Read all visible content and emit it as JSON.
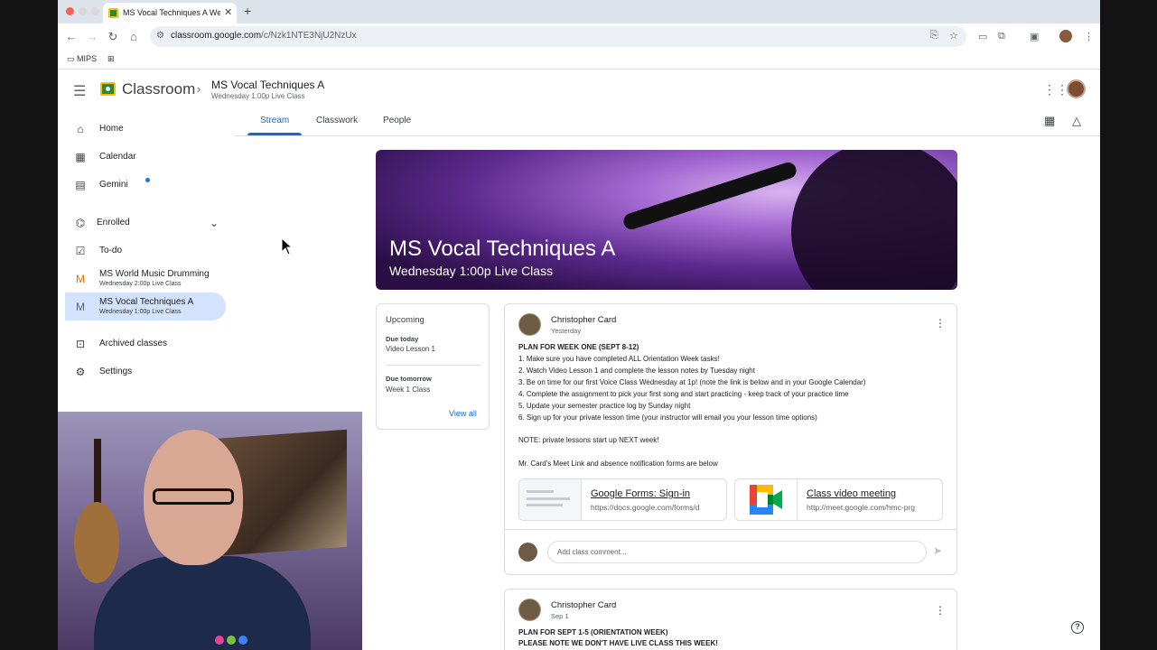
{
  "browser": {
    "tab_title": "MS Vocal Techniques A Wedn",
    "tab_close": "✕",
    "new_tab": "+",
    "url_host": "classroom.google.com",
    "url_path": "/c/Nzk1NTE3NjU2NzUx",
    "bookmarks": [
      {
        "label": "MIPS",
        "icon": "folder-icon"
      },
      {
        "label": "",
        "icon": "apps-grid-icon"
      }
    ]
  },
  "header": {
    "app_name": "Classroom",
    "class_name": "MS Vocal Techniques A",
    "class_sub": "Wednesday 1:00p Live Class"
  },
  "tabs": [
    {
      "label": "Stream",
      "active": true
    },
    {
      "label": "Classwork",
      "active": false
    },
    {
      "label": "People",
      "active": false
    }
  ],
  "sidebar": {
    "items": [
      {
        "label": "Home",
        "icon": "home-icon"
      },
      {
        "label": "Calendar",
        "icon": "calendar-icon"
      },
      {
        "label": "Gemini",
        "icon": "gemini-icon"
      },
      {
        "label": "Enrolled",
        "icon": "enrolled-icon"
      },
      {
        "label": "To-do",
        "icon": "todo-icon"
      },
      {
        "label": "MS World Music Drumming",
        "sub": "Wednesday 2:00p Live Class",
        "letter": "M"
      },
      {
        "label": "MS Vocal Techniques A",
        "sub": "Wednesday 1:00p Live Class",
        "letter": "M"
      },
      {
        "label": "Archived classes",
        "icon": "archive-icon"
      },
      {
        "label": "Settings",
        "icon": "gear-icon"
      }
    ]
  },
  "banner": {
    "title": "MS Vocal Techniques A",
    "subtitle": "Wednesday 1:00p Live Class"
  },
  "upcoming": {
    "title": "Upcoming",
    "due_today_label": "Due today",
    "due_today_item": "Video Lesson 1",
    "due_tomorrow_label": "Due tomorrow",
    "due_tomorrow_item": "Week 1 Class",
    "view_all": "View all"
  },
  "posts": [
    {
      "author": "Christopher Card",
      "date": "Yesterday",
      "lines": [
        "PLAN FOR WEEK ONE (SEPT 8-12)",
        "1.  Make sure you have completed ALL Orientation Week tasks!",
        "2.  Watch Video Lesson 1 and complete the lesson notes by Tuesday night",
        "3.  Be on time for our first Voice Class Wednesday at 1p!  (note the link is below and in your Google Calendar)",
        "4.  Complete the assignment to pick your first song and start practicing - keep track of your practice time",
        "5.  Update your semester practice log by Sunday night",
        "6.  Sign up for your private lesson time (your instructor will email you your lesson time options)",
        "NOTE:  private lessons start up NEXT week!",
        "Mr. Card's Meet Link and absence notification forms are below"
      ],
      "attachments": [
        {
          "title": "Google Forms: Sign-in",
          "url": "https://docs.google.com/forms/d"
        },
        {
          "title": "Class video meeting",
          "url": "http://meet.google.com/hmc-prg"
        }
      ],
      "comment_placeholder": "Add class comment..."
    },
    {
      "author": "Christopher Card",
      "date": "Sep 1",
      "lines": [
        "PLAN FOR SEPT 1-5 (ORIENTATION WEEK)",
        "PLEASE NOTE WE DON'T HAVE LIVE CLASS THIS WEEK!"
      ]
    }
  ],
  "icons": {
    "help": "?",
    "more": "⋮",
    "send": "➤",
    "chevron": "›"
  }
}
